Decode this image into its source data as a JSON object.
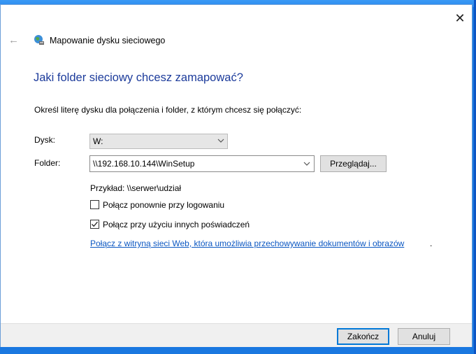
{
  "window": {
    "title": "Mapowanie dysku sieciowego",
    "close_glyph": "✕",
    "back_glyph": "←"
  },
  "heading": "Jaki folder sieciowy chcesz zamapować?",
  "instruction": "Określ literę dysku dla połączenia i folder, z którym chcesz się połączyć:",
  "drive": {
    "label": "Dysk:",
    "value": "W:"
  },
  "folder": {
    "label": "Folder:",
    "value": "\\\\192.168.10.144\\WinSetup",
    "browse_label": "Przeglądaj..."
  },
  "example": "Przykład: \\\\serwer\\udział",
  "checkboxes": [
    {
      "label": "Połącz ponownie przy logowaniu",
      "checked": false
    },
    {
      "label": "Połącz przy użyciu innych poświadczeń",
      "checked": true
    }
  ],
  "link": {
    "text": "Połącz z witryną sieci Web, która umożliwia przechowywanie dokumentów i obrazów",
    "trailing": "."
  },
  "buttons": {
    "finish": "Zakończ",
    "cancel": "Anuluj"
  },
  "colors": {
    "heading": "#1c3b9b",
    "link": "#0b57c2",
    "accent": "#0078d7",
    "desktop": "#1a78e0"
  },
  "icons": {
    "window": "network-drive-icon",
    "back": "back-arrow-icon",
    "close": "close-icon"
  }
}
